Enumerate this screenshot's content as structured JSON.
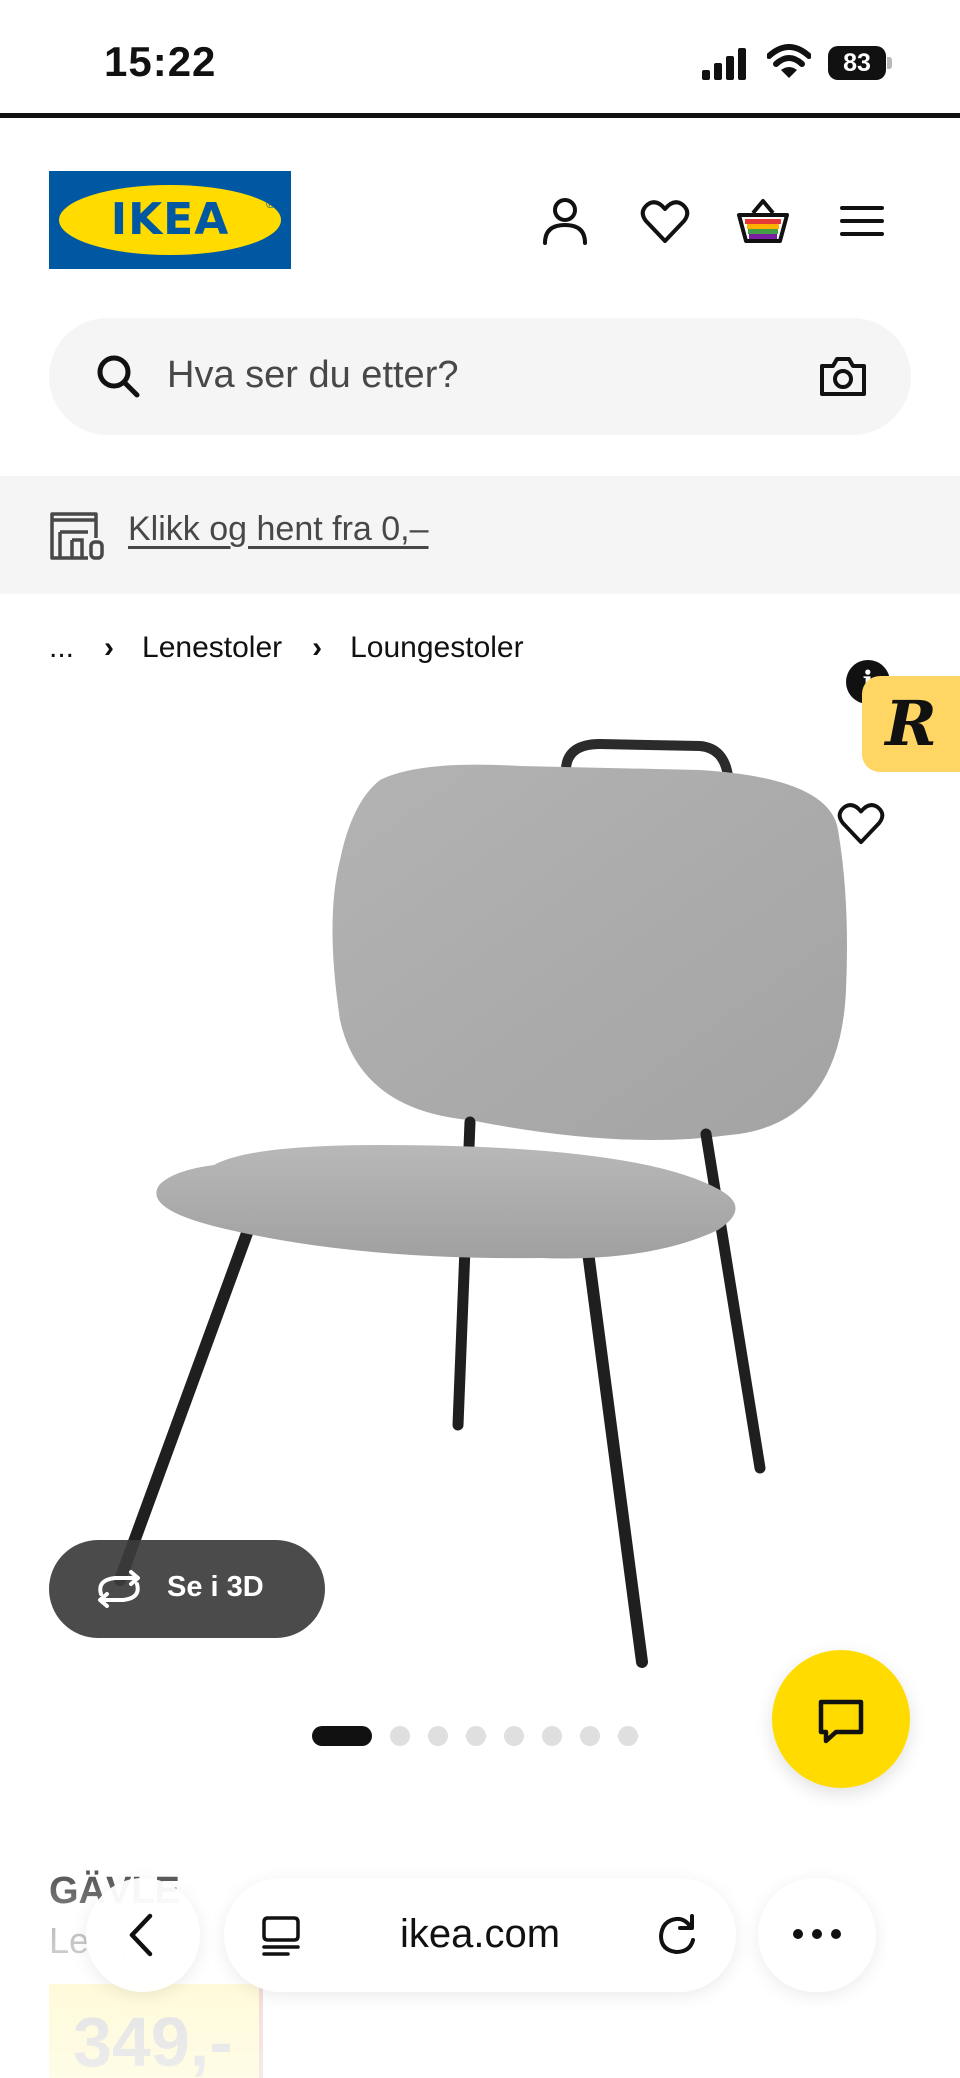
{
  "status_bar": {
    "time": "15:22",
    "battery": "83",
    "icons": [
      "cellular-signal-icon",
      "wifi-icon",
      "battery-icon"
    ]
  },
  "header": {
    "logo_text": "IKEA",
    "icons": [
      "account-icon",
      "heart-icon",
      "basket-icon",
      "menu-icon"
    ]
  },
  "search": {
    "placeholder": "Hva ser du etter?",
    "icons": [
      "search-icon",
      "camera-icon"
    ]
  },
  "promo": {
    "link_text": "Klikk og hent fra 0,–",
    "icon": "store-pickup-icon"
  },
  "breadcrumb": {
    "ellipsis": "...",
    "items": [
      "Lenestoler",
      "Loungestoler"
    ],
    "separator": "›"
  },
  "gallery": {
    "view_3d_label": "Se i 3D",
    "slide_count": 8,
    "active_slide": 1,
    "badges": {
      "info": "i",
      "r": "R"
    }
  },
  "product": {
    "name": "GÄVLE",
    "description": "Le...,",
    "price": "349,-"
  },
  "browser": {
    "url": "ikea.com",
    "icons": [
      "back-icon",
      "tabs-icon",
      "reload-icon",
      "more-icon"
    ]
  },
  "colors": {
    "ikea_blue": "#0058a3",
    "ikea_yellow": "#ffdb00",
    "price_highlight": "#fff3a0",
    "r_badge": "#ffd564"
  }
}
